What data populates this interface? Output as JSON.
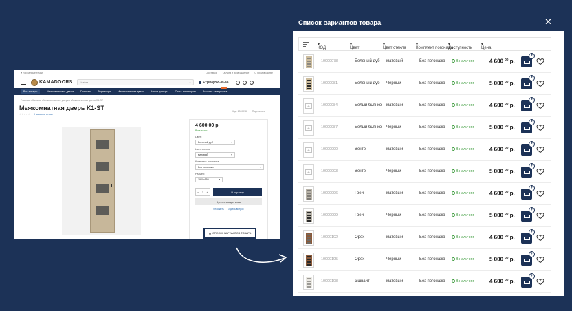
{
  "site": {
    "topbar_left": "♥ Избранные точки",
    "topbar_right": [
      "Доставка",
      "Оплата и возвращение",
      "О производстве"
    ],
    "logo": "KAMADOORS",
    "search_placeholder": "Найти",
    "phone": "+7(800)700-05-50",
    "nav": [
      "Все товары",
      "Межкомнатные двери",
      "Погонаж",
      "Фурнитура",
      "Металлические двери",
      "Наши дилеры",
      "Стать партнером",
      "Вызвать замерщика"
    ],
    "breadcrumb": "Главная • Каталог • Межкомнатные двери • Межкомнатная дверь K1-ST",
    "product_title": "Межкомнатная дверь K1-ST",
    "review_link": "Написать отзыв",
    "meta": [
      "Код: 1000078",
      "Поделиться"
    ],
    "price": "4 600,00 р.",
    "availability": "В наличии",
    "options": [
      {
        "label": "Цвет:",
        "value": "Беленый дуб"
      },
      {
        "label": "Цвет стекла:",
        "value": "матовый"
      },
      {
        "label": "Комплект погонажа:",
        "value": "Без погонажа"
      },
      {
        "label": "Размер:",
        "value": "1900х550"
      }
    ],
    "qty": "1",
    "cart_button": "В корзину",
    "one_click_button": "Купить в один клик",
    "links": [
      "Отложить",
      "Задать вопрос"
    ],
    "variants_button": "СПИСОК ВАРИАНТОВ ТОВАРА"
  },
  "modal": {
    "title": "Список вариантов товара",
    "close": "✕",
    "columns": [
      "КОД",
      "Цвет",
      "Цвет стекла",
      "Комплект погонажа",
      "Доступность",
      "Цена"
    ],
    "rows": [
      {
        "code": "10000078",
        "color": "Беленый дуб",
        "glass": "матовый",
        "kit": "Без погонажа",
        "availability": "В наличии",
        "price": "4 600",
        "cents": "00",
        "currency": "р.",
        "thumb": "door-light"
      },
      {
        "code": "10000081",
        "color": "Беленый дуб",
        "glass": "Чёрный",
        "kit": "Без погонажа",
        "availability": "В наличии",
        "price": "5 000",
        "cents": "00",
        "currency": "р.",
        "thumb": "door-light-black"
      },
      {
        "code": "10000084",
        "color": "Белый бьянко",
        "glass": "матовый",
        "kit": "Без погонажа",
        "availability": "В наличии",
        "price": "4 600",
        "cents": "00",
        "currency": "р.",
        "thumb": "placeholder"
      },
      {
        "code": "10000087",
        "color": "Белый бьянко",
        "glass": "Чёрный",
        "kit": "Без погонажа",
        "availability": "В наличии",
        "price": "5 000",
        "cents": "00",
        "currency": "р.",
        "thumb": "placeholder"
      },
      {
        "code": "10000090",
        "color": "Венге",
        "glass": "матовый",
        "kit": "Без погонажа",
        "availability": "В наличии",
        "price": "4 600",
        "cents": "00",
        "currency": "р.",
        "thumb": "placeholder"
      },
      {
        "code": "10000093",
        "color": "Венге",
        "glass": "Чёрный",
        "kit": "Без погонажа",
        "availability": "В наличии",
        "price": "5 000",
        "cents": "00",
        "currency": "р.",
        "thumb": "placeholder"
      },
      {
        "code": "10000096",
        "color": "Грей",
        "glass": "матовый",
        "kit": "Без погонажа",
        "availability": "В наличии",
        "price": "4 600",
        "cents": "00",
        "currency": "р.",
        "thumb": "door-grey"
      },
      {
        "code": "10000099",
        "color": "Грей",
        "glass": "Чёрный",
        "kit": "Без погонажа",
        "availability": "В наличии",
        "price": "5 000",
        "cents": "00",
        "currency": "р.",
        "thumb": "door-grey-black"
      },
      {
        "code": "10000102",
        "color": "Орех",
        "glass": "матовый",
        "kit": "Без погонажа",
        "availability": "В наличии",
        "price": "4 600",
        "cents": "00",
        "currency": "р.",
        "thumb": "door-walnut"
      },
      {
        "code": "10000105",
        "color": "Орех",
        "glass": "Чёрный",
        "kit": "Без погонажа",
        "availability": "В наличии",
        "price": "5 000",
        "cents": "00",
        "currency": "р.",
        "thumb": "door-walnut-black"
      },
      {
        "code": "10000108",
        "color": "Эшвайт",
        "glass": "матовый",
        "kit": "Без погонажа",
        "availability": "В наличии",
        "price": "4 600",
        "cents": "00",
        "currency": "р.",
        "thumb": "door-white"
      }
    ]
  },
  "colors": {
    "background": "#1c3257",
    "accent": "#1c3257",
    "available": "#3a9a3a",
    "hot_badge": "#e8692b"
  }
}
